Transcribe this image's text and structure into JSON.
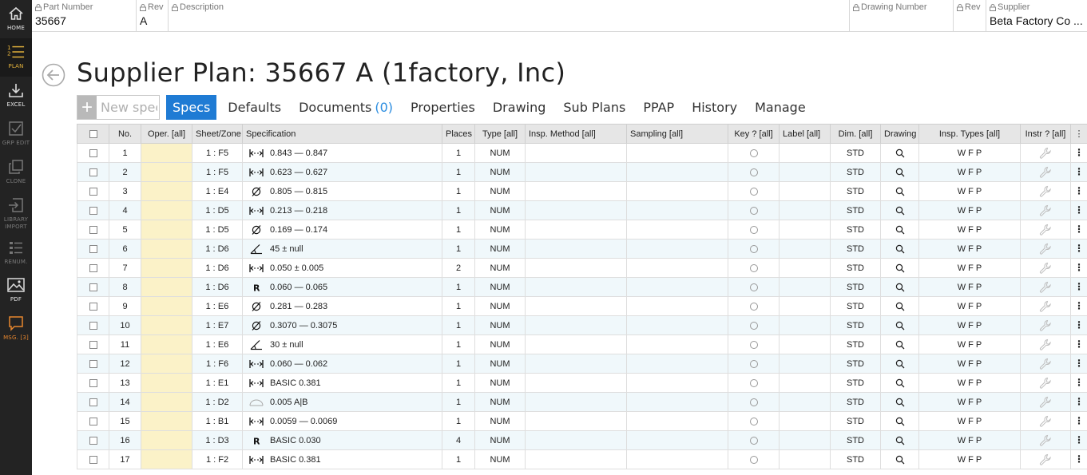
{
  "sidebar": [
    {
      "label": "HOME",
      "icon": "home-icon",
      "tone": "white"
    },
    {
      "label": "PLAN",
      "icon": "numbered-list-icon",
      "tone": "yellow"
    },
    {
      "label": "EXCEL",
      "icon": "download-icon",
      "tone": "white"
    },
    {
      "label": "GRP EDIT",
      "icon": "check-square-icon",
      "tone": "gray"
    },
    {
      "label": "CLONE",
      "icon": "clone-icon",
      "tone": "gray"
    },
    {
      "label": "LIBRARY IMPORT",
      "icon": "import-icon",
      "tone": "gray"
    },
    {
      "label": "RENUM.",
      "icon": "renumber-icon",
      "tone": "gray"
    },
    {
      "label": "PDF",
      "icon": "image-icon",
      "tone": "white"
    },
    {
      "label": "MSG. [3]",
      "icon": "message-icon",
      "tone": "orange"
    }
  ],
  "header": {
    "part_number": {
      "label": "Part Number",
      "value": "35667"
    },
    "rev": {
      "label": "Rev",
      "value": "A"
    },
    "description": {
      "label": "Description",
      "value": ""
    },
    "drawing_number": {
      "label": "Drawing Number",
      "value": ""
    },
    "drawing_rev": {
      "label": "Rev",
      "value": ""
    },
    "supplier": {
      "label": "Supplier",
      "value": "Beta Factory Co ..."
    }
  },
  "page_title": "Supplier Plan: 35667 A (1factory, Inc)",
  "new_spec_placeholder": "New spec",
  "tabs": [
    {
      "label": "Specs",
      "active": true
    },
    {
      "label": "Defaults"
    },
    {
      "label": "Documents",
      "count": "(0)"
    },
    {
      "label": "Properties"
    },
    {
      "label": "Drawing"
    },
    {
      "label": "Sub Plans"
    },
    {
      "label": "PPAP"
    },
    {
      "label": "History"
    },
    {
      "label": "Manage"
    }
  ],
  "columns": {
    "no": "No.",
    "oper": "Oper. [all]",
    "sheet": "Sheet/Zone",
    "spec": "Specification",
    "places": "Places",
    "type": "Type [all]",
    "insp_method": "Insp. Method [all]",
    "sampling": "Sampling [all]",
    "key": "Key ? [all]",
    "label": "Label [all]",
    "dim": "Dim. [all]",
    "drawing": "Drawing",
    "insp_types": "Insp. Types [all]",
    "instr": "Instr ? [all]",
    "menu": "⋮"
  },
  "rows": [
    {
      "no": "1",
      "sheet": "1 : F5",
      "sym": "dim",
      "spec": "0.843 — 0.847",
      "places": "1",
      "type": "NUM",
      "dim": "STD",
      "insp": "W F P"
    },
    {
      "no": "2",
      "sheet": "1 : F5",
      "sym": "dim",
      "spec": "0.623 — 0.627",
      "places": "1",
      "type": "NUM",
      "dim": "STD",
      "insp": "W F P"
    },
    {
      "no": "3",
      "sheet": "1 : E4",
      "sym": "dia",
      "spec": "0.805 — 0.815",
      "places": "1",
      "type": "NUM",
      "dim": "STD",
      "insp": "W F P"
    },
    {
      "no": "4",
      "sheet": "1 : D5",
      "sym": "dim",
      "spec": "0.213 — 0.218",
      "places": "1",
      "type": "NUM",
      "dim": "STD",
      "insp": "W F P"
    },
    {
      "no": "5",
      "sheet": "1 : D5",
      "sym": "dia",
      "spec": "0.169 — 0.174",
      "places": "1",
      "type": "NUM",
      "dim": "STD",
      "insp": "W F P"
    },
    {
      "no": "6",
      "sheet": "1 : D6",
      "sym": "ang",
      "spec": "45 ± null",
      "places": "1",
      "type": "NUM",
      "dim": "STD",
      "insp": "W F P"
    },
    {
      "no": "7",
      "sheet": "1 : D6",
      "sym": "dim",
      "spec": "0.050 ± 0.005",
      "places": "2",
      "type": "NUM",
      "dim": "STD",
      "insp": "W F P"
    },
    {
      "no": "8",
      "sheet": "1 : D6",
      "sym": "rad",
      "spec": "0.060 — 0.065",
      "places": "1",
      "type": "NUM",
      "dim": "STD",
      "insp": "W F P"
    },
    {
      "no": "9",
      "sheet": "1 : E6",
      "sym": "dia",
      "spec": "0.281 — 0.283",
      "places": "1",
      "type": "NUM",
      "dim": "STD",
      "insp": "W F P"
    },
    {
      "no": "10",
      "sheet": "1 : E7",
      "sym": "dia",
      "spec": "0.3070 — 0.3075",
      "places": "1",
      "type": "NUM",
      "dim": "STD",
      "insp": "W F P"
    },
    {
      "no": "11",
      "sheet": "1 : E6",
      "sym": "ang",
      "spec": "30 ± null",
      "places": "1",
      "type": "NUM",
      "dim": "STD",
      "insp": "W F P"
    },
    {
      "no": "12",
      "sheet": "1 : F6",
      "sym": "dim",
      "spec": "0.060 — 0.062",
      "places": "1",
      "type": "NUM",
      "dim": "STD",
      "insp": "W F P"
    },
    {
      "no": "13",
      "sheet": "1 : E1",
      "sym": "dim",
      "spec": "BASIC 0.381",
      "places": "1",
      "type": "NUM",
      "dim": "STD",
      "insp": "W F P"
    },
    {
      "no": "14",
      "sheet": "1 : D2",
      "sym": "prof",
      "spec": "0.005 A|B",
      "places": "1",
      "type": "NUM",
      "dim": "STD",
      "insp": "W F P"
    },
    {
      "no": "15",
      "sheet": "1 : B1",
      "sym": "dim",
      "spec": "0.0059 — 0.0069",
      "places": "1",
      "type": "NUM",
      "dim": "STD",
      "insp": "W F P"
    },
    {
      "no": "16",
      "sheet": "1 : D3",
      "sym": "rad",
      "spec": "BASIC 0.030",
      "places": "4",
      "type": "NUM",
      "dim": "STD",
      "insp": "W F P"
    },
    {
      "no": "17",
      "sheet": "1 : F2",
      "sym": "dim",
      "spec": "BASIC 0.381",
      "places": "1",
      "type": "NUM",
      "dim": "STD",
      "insp": "W F P"
    }
  ],
  "colors": {
    "accent": "#1f7bd4",
    "oper_bg": "#fbf2c8",
    "sidebar_bg": "#232323",
    "row_alt": "#f0f8fb"
  }
}
